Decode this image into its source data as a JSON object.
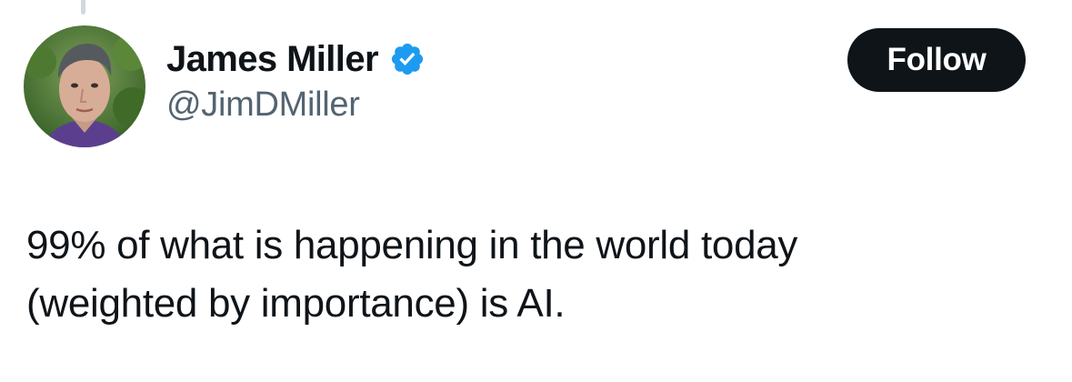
{
  "author": {
    "display_name": "James Miller",
    "handle": "@JimDMiller",
    "verified": true,
    "verified_icon": "verified-badge-icon",
    "avatar": "profile-photo",
    "accent_color": "#1d9bf0"
  },
  "actions": {
    "follow_label": "Follow"
  },
  "tweet": {
    "text_line1": "99% of what is happening in the world today",
    "text_line2": "(weighted by importance) is AI."
  },
  "colors": {
    "text_primary": "#0f1419",
    "text_secondary": "#536471",
    "button_bg": "#0f1419",
    "verified_blue": "#1d9bf0"
  }
}
